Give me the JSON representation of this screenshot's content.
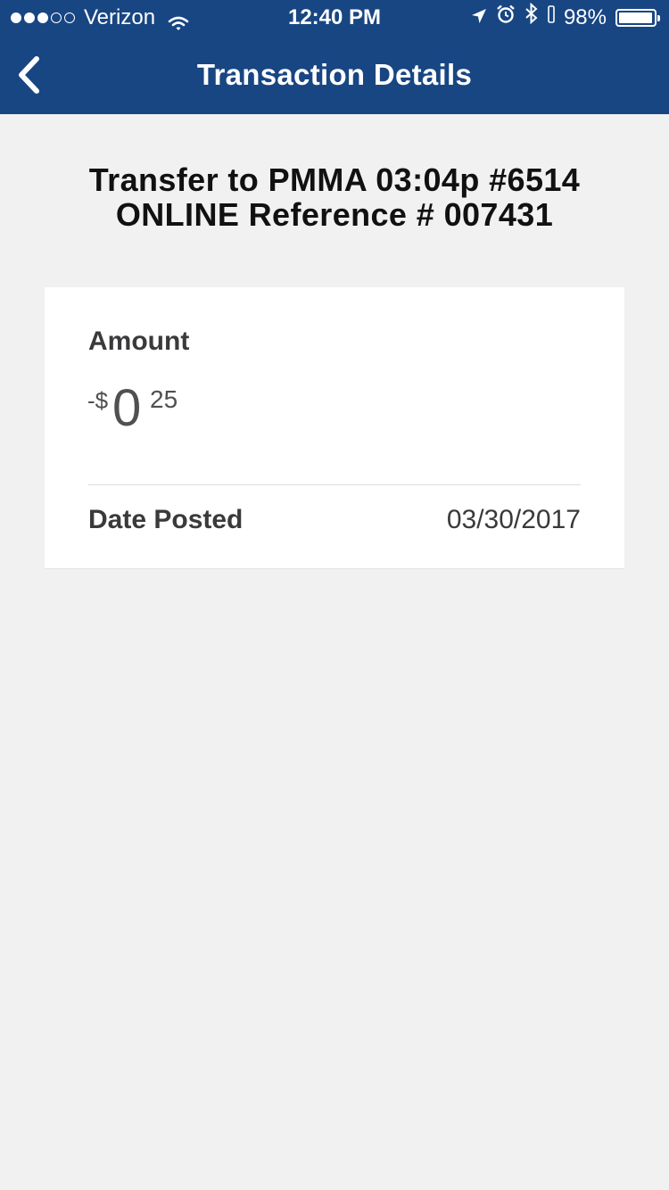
{
  "status_bar": {
    "carrier": "Verizon",
    "time": "12:40 PM",
    "battery": "98%",
    "icons": [
      "signal-dots-icon",
      "wifi-icon",
      "location-arrow-icon",
      "alarm-icon",
      "bluetooth-icon",
      "battery-icon"
    ]
  },
  "nav": {
    "title": "Transaction Details",
    "back_icon": "chevron-left-icon"
  },
  "transaction": {
    "title_line1": "Transfer to PMMA 03:04p #6514",
    "title_line2": "ONLINE Reference # 007431"
  },
  "details": {
    "amount_label": "Amount",
    "amount_sign": "-$",
    "amount_whole": "0",
    "amount_cents": "25",
    "date_label": "Date Posted",
    "date_value": "03/30/2017"
  },
  "colors": {
    "header_bg": "#184683",
    "page_bg": "#f1f1f2",
    "card_bg": "#ffffff"
  }
}
